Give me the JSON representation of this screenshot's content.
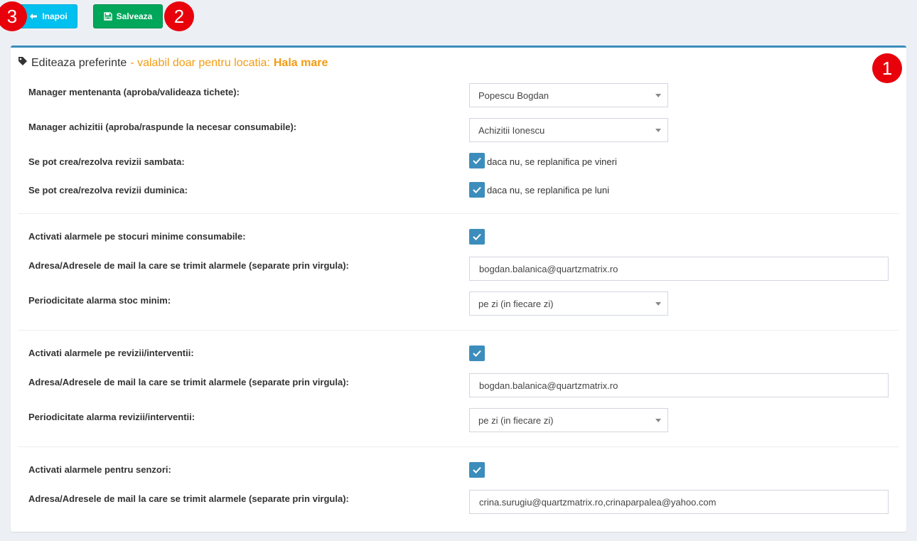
{
  "toolbar": {
    "back_label": "Inapoi",
    "save_label": "Salveaza"
  },
  "markers": [
    "1",
    "2",
    "3"
  ],
  "panel": {
    "title": "Editeaza preferinte",
    "subtitle": "- valabil doar pentru locatia:",
    "location": "Hala mare"
  },
  "general": {
    "manager_mentenanta": {
      "label": "Manager mentenanta (aproba/valideaza tichete):",
      "value": "Popescu Bogdan"
    },
    "manager_achizitii": {
      "label": "Manager achizitii (aproba/raspunde la necesar consumabile):",
      "value": "Achizitii Ionescu"
    },
    "sambata": {
      "label": "Se pot crea/rezolva revizii sambata:",
      "checked": true,
      "text": "daca nu, se replanifica pe vineri"
    },
    "duminica": {
      "label": "Se pot crea/rezolva revizii duminica:",
      "checked": true,
      "text": "daca nu, se replanifica pe luni"
    }
  },
  "stocuri": {
    "activate": {
      "label": "Activati alarmele pe stocuri minime consumabile:",
      "checked": true
    },
    "email": {
      "label": "Adresa/Adresele de mail la care se trimit alarmele (separate prin virgula):",
      "value": "bogdan.balanica@quartzmatrix.ro"
    },
    "periodicity": {
      "label": "Periodicitate alarma stoc minim:",
      "value": "pe zi (in fiecare zi)"
    }
  },
  "revizii": {
    "activate": {
      "label": "Activati alarmele pe revizii/interventii:",
      "checked": true
    },
    "email": {
      "label": "Adresa/Adresele de mail la care se trimit alarmele (separate prin virgula):",
      "value": "bogdan.balanica@quartzmatrix.ro"
    },
    "periodicity": {
      "label": "Periodicitate alarma revizii/interventii:",
      "value": "pe zi (in fiecare zi)"
    }
  },
  "senzori": {
    "activate": {
      "label": "Activati alarmele pentru senzori:",
      "checked": true
    },
    "email": {
      "label": "Adresa/Adresele de mail la care se trimit alarmele (separate prin virgula):",
      "value": "crina.surugiu@quartzmatrix.ro,crinaparpalea@yahoo.com"
    }
  },
  "colors": {
    "accent": "#3c8dbc",
    "back_button": "#00c0ef",
    "save_button": "#00a65a",
    "location_highlight": "#f39c12",
    "marker": "#e8000b"
  }
}
